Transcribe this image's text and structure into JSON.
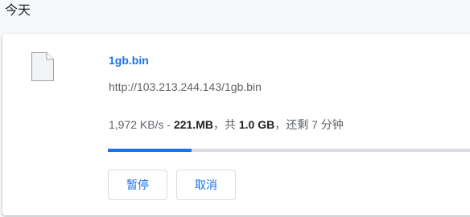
{
  "date_header": "今天",
  "download": {
    "file_name": "1gb.bin",
    "url": "http://103.213.244.143/1gb.bin",
    "speed": "1,972 KB/s",
    "sep1": " - ",
    "downloaded": "221.MB",
    "sep2": "，共 ",
    "total": "1.0 GB",
    "sep3": "，还剩 7 分钟",
    "progress_fraction": 0.2211,
    "pause_label": "暂停",
    "cancel_label": "取消"
  },
  "icons": {
    "file": "file-icon"
  },
  "colors": {
    "accent": "#1a73e8",
    "track": "#dadce0",
    "text_secondary": "#5f6368"
  }
}
